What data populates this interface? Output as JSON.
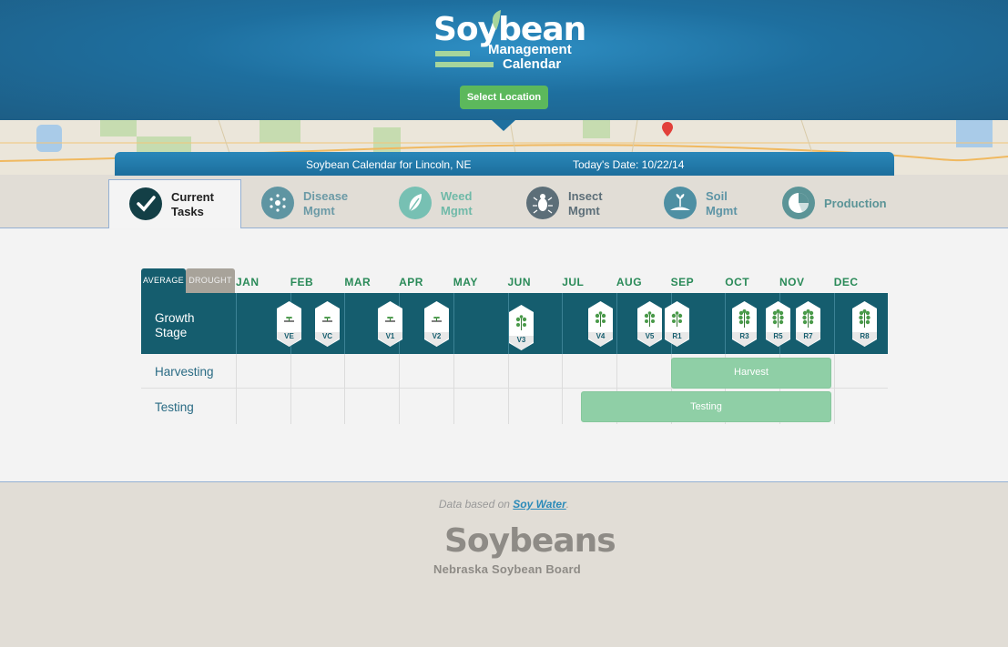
{
  "app": {
    "logo_main": "Soybean",
    "logo_sub1": "Management",
    "logo_sub2": "Calendar",
    "select_location": "Select Location"
  },
  "infobar": {
    "location": "Soybean Calendar for Lincoln, NE",
    "date": "Today's Date: 10/22/14"
  },
  "tabs": [
    {
      "label1": "Current",
      "label2": "Tasks",
      "icon": "check-icon",
      "active": true
    },
    {
      "label1": "Disease",
      "label2": "Mgmt",
      "icon": "disease-icon"
    },
    {
      "label1": "Weed",
      "label2": "Mgmt",
      "icon": "weed-leaf-icon"
    },
    {
      "label1": "Insect",
      "label2": "Mgmt",
      "icon": "insect-icon"
    },
    {
      "label1": "Soil",
      "label2": "Mgmt",
      "icon": "soil-icon"
    },
    {
      "label1": "Production",
      "label2": "",
      "icon": "production-pie-icon"
    }
  ],
  "calendar": {
    "toggle_average": "AVERAGE",
    "toggle_drought": "DROUGHT",
    "months": [
      "JAN",
      "FEB",
      "MAR",
      "APR",
      "MAY",
      "JUN",
      "JUL",
      "AUG",
      "SEP",
      "OCT",
      "NOV",
      "DEC"
    ],
    "growth_label1": "Growth",
    "growth_label2": "Stage",
    "stages": [
      "VE",
      "VC",
      "V1",
      "V2",
      "V3",
      "V4",
      "V5",
      "R1",
      "R3",
      "R5",
      "R7",
      "R8"
    ],
    "harvesting_label": "Harvesting",
    "testing_label": "Testing",
    "harvest_bar": "Harvest",
    "testing_bar": "Testing"
  },
  "footer": {
    "credit_prefix": "Data based on ",
    "credit_link": "Soy Water",
    "credit_suffix": ".",
    "logo": "Soybeans",
    "board": "Nebraska Soybean Board"
  },
  "colors": {
    "header": "#1e6f9f",
    "button": "#5cb85c",
    "teal": "#155d6e",
    "bar": "#8fcfa6"
  }
}
